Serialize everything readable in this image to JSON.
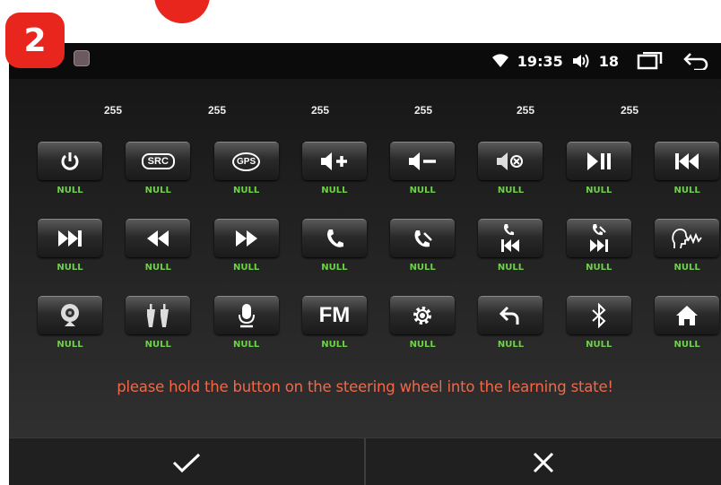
{
  "step_badge": "2",
  "status": {
    "time": "19:35",
    "volume": "18"
  },
  "values": [
    "255",
    "255",
    "255",
    "255",
    "255",
    "255"
  ],
  "buttons": [
    {
      "icon": "power-icon",
      "label": "NULL"
    },
    {
      "icon": "src-icon",
      "text": "SRC",
      "label": "NULL"
    },
    {
      "icon": "gps-icon",
      "text": "GPS",
      "label": "NULL"
    },
    {
      "icon": "volume-up-icon",
      "label": "NULL"
    },
    {
      "icon": "volume-down-icon",
      "label": "NULL"
    },
    {
      "icon": "mute-icon",
      "label": "NULL"
    },
    {
      "icon": "play-pause-icon",
      "label": "NULL"
    },
    {
      "icon": "previous-track-icon",
      "label": "NULL"
    },
    {
      "icon": "next-track-icon",
      "label": "NULL"
    },
    {
      "icon": "rewind-icon",
      "label": "NULL"
    },
    {
      "icon": "fast-forward-icon",
      "label": "NULL"
    },
    {
      "icon": "phone-answer-icon",
      "label": "NULL"
    },
    {
      "icon": "phone-hangup-icon",
      "label": "NULL"
    },
    {
      "icon": "phone-previous-icon",
      "label": "NULL"
    },
    {
      "icon": "phone-next-icon",
      "label": "NULL"
    },
    {
      "icon": "voice-icon",
      "label": "NULL"
    },
    {
      "icon": "camera-icon",
      "label": "NULL"
    },
    {
      "icon": "rca-audio-icon",
      "label": "NULL"
    },
    {
      "icon": "microphone-icon",
      "label": "NULL"
    },
    {
      "icon": "fm-icon",
      "text": "FM",
      "label": "NULL"
    },
    {
      "icon": "settings-icon",
      "label": "NULL"
    },
    {
      "icon": "back-icon",
      "label": "NULL"
    },
    {
      "icon": "bluetooth-icon",
      "label": "NULL"
    },
    {
      "icon": "home-icon",
      "label": "NULL"
    }
  ],
  "instruction": "please hold the button on the steering wheel into the learning state!",
  "colors": {
    "badge": "#e8261d",
    "label_green": "#6fd14a",
    "instruction": "#f0684a"
  }
}
